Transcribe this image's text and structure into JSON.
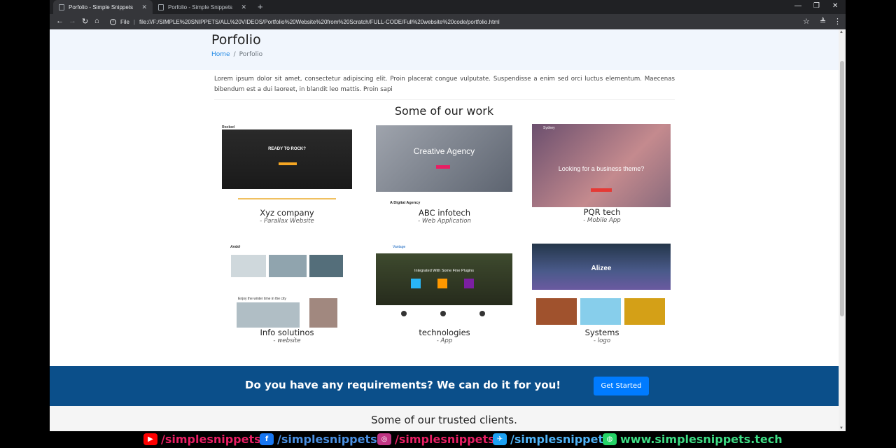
{
  "browser": {
    "tabs": [
      {
        "label": "Porfolio - Simple Snippets"
      },
      {
        "label": "Porfolio - Simple Snippets"
      }
    ],
    "new_tab": "+",
    "address": {
      "scheme": "File",
      "url": "file:///F:/SIMPLE%20SNIPPETS/ALL%20VIDEOS/Portfolio%20Website%20from%20Scratch/FULL-CODE/Full%20website%20code/portfolio.html"
    }
  },
  "header": {
    "title": "Porfolio",
    "breadcrumb": {
      "home": "Home",
      "separator": "/",
      "current": "Porfolio"
    }
  },
  "intro": "Lorem ipsum dolor sit amet, consectetur adipiscing elit. Proin placerat congue vulputate. Suspendisse a enim sed orci luctus elementum. Maecenas bibendum est a dui laoreet, in blandit leo mattis. Proin sapi",
  "work": {
    "title": "Some of our work",
    "items": [
      {
        "title": "Xyz company",
        "subtitle": "- Parallax Website",
        "thumb_text": "READY TO ROCK?",
        "thumb_brand": "Rocked"
      },
      {
        "title": "ABC infotech",
        "subtitle": "- Web Application",
        "thumb_text": "Creative Agency",
        "thumb_brand": "A Digital Agency"
      },
      {
        "title": "PQR tech",
        "subtitle": "- Mobile App",
        "thumb_text": "Looking for a business theme?",
        "thumb_brand": "Sydney"
      },
      {
        "title": "Info solutinos",
        "subtitle": "- website",
        "thumb_text": "Enjoy the winter time in the city",
        "thumb_brand": "Ambit"
      },
      {
        "title": "technologies",
        "subtitle": "- App",
        "thumb_text": "Integrated With Some Fine Plugins",
        "thumb_brand": "Vantage"
      },
      {
        "title": "Systems",
        "subtitle": "- logo",
        "thumb_text": "Alizee",
        "thumb_brand": ""
      }
    ]
  },
  "cta": {
    "text": "Do you have any requirements? We can do it for you!",
    "button": "Get Started"
  },
  "clients": {
    "title": "Some of our trusted clients."
  },
  "social": {
    "youtube": "/simplesnippets",
    "facebook": "/simplesnippets",
    "instagram": "/simplesnippets",
    "twitter": "/simplesnippet",
    "website": "www.simplesnippets.tech",
    "colors": {
      "youtube": "#ff0000",
      "facebook": "#1877f2",
      "instagram": "#c13584",
      "twitter": "#1da1f2",
      "website": "#25d366"
    }
  }
}
